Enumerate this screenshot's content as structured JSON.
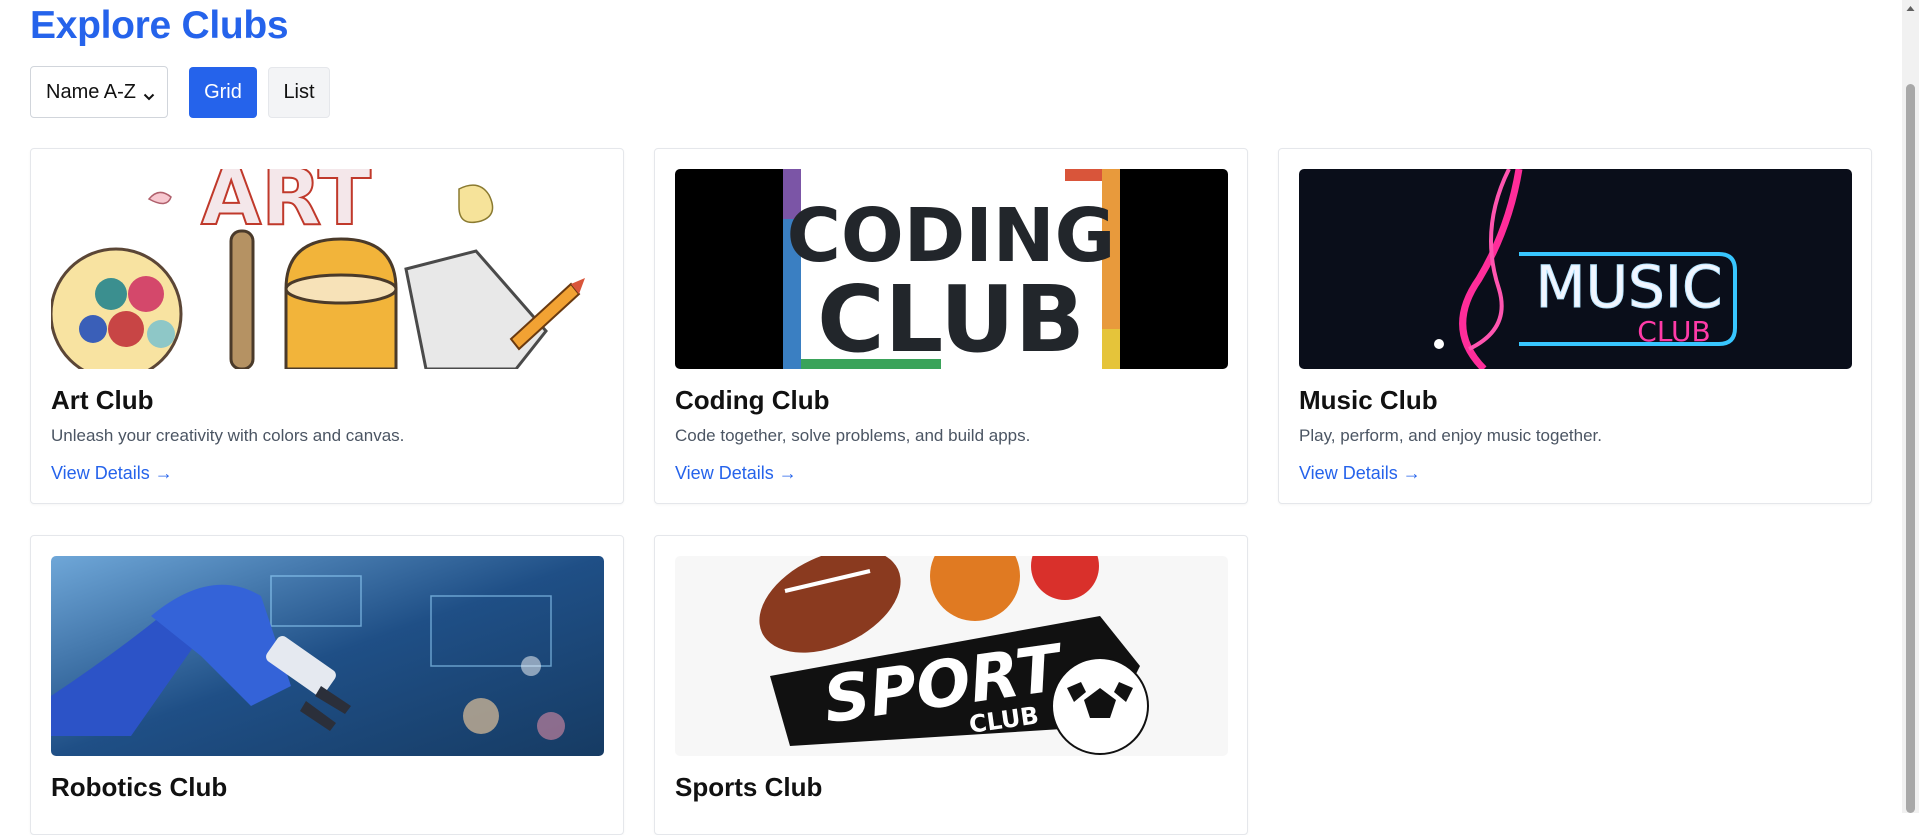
{
  "page": {
    "title": "Explore Clubs"
  },
  "controls": {
    "sort_selected": "Name A-Z",
    "grid_label": "Grid",
    "list_label": "List"
  },
  "clubs": [
    {
      "name": "Art Club",
      "description": "Unleash your creativity with colors and canvas.",
      "link": "View Details →"
    },
    {
      "name": "Coding Club",
      "description": "Code together, solve problems, and build apps.",
      "link": "View Details →"
    },
    {
      "name": "Music Club",
      "description": "Play, perform, and enjoy music together.",
      "link": "View Details →"
    },
    {
      "name": "Robotics Club",
      "description": "",
      "link": ""
    },
    {
      "name": "Sports Club",
      "description": "",
      "link": ""
    }
  ],
  "images": {
    "art": {
      "text": "ART"
    },
    "coding": {
      "line1": "CODING",
      "line2": "CLUB"
    },
    "music": {
      "line1": "MUSIC",
      "line2": "CLUB"
    },
    "sports": {
      "line1": "SPORT",
      "line2": "CLUB"
    }
  },
  "colors": {
    "accent": "#2563eb",
    "list_bg": "#f3f4f6"
  }
}
